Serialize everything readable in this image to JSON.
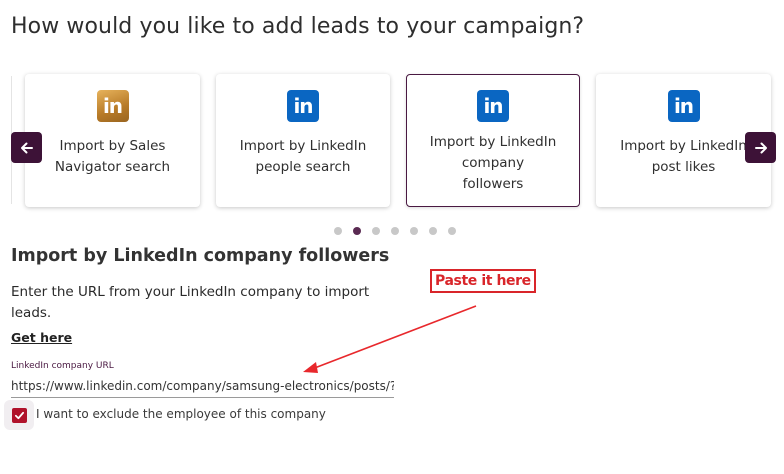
{
  "page": {
    "title": "How would you like to add leads to your campaign?"
  },
  "carousel": {
    "cards": [
      {
        "label_line1": "Import by Sales",
        "label_line2": "Navigator search",
        "label_line3": "",
        "icon": "linkedin-sales-navigator-icon",
        "selected": false
      },
      {
        "label_line1": "Import by LinkedIn",
        "label_line2": "people search",
        "label_line3": "",
        "icon": "linkedin-icon",
        "selected": false
      },
      {
        "label_line1": "Import by LinkedIn",
        "label_line2": "company",
        "label_line3": "followers",
        "icon": "linkedin-icon",
        "selected": true
      },
      {
        "label_line1": "Import by LinkedIn",
        "label_line2": "post likes",
        "label_line3": "",
        "icon": "linkedin-icon",
        "selected": false
      }
    ],
    "icon_text": "in",
    "prev_icon": "arrow-left-icon",
    "next_icon": "arrow-right-icon",
    "dots_count": 7,
    "active_dot": 2
  },
  "section": {
    "title": "Import by LinkedIn company followers",
    "description": "Enter the URL from your LinkedIn company to import leads.",
    "get_here_link": "Get here",
    "field_label": "LinkedIn company URL",
    "url_value": "https://www.linkedin.com/company/samsung-electronics/posts/?feedView=all",
    "url_placeholder": "",
    "exclude_checkbox": {
      "checked": true,
      "label": "I want to exclude the employee of this company"
    }
  },
  "annotation": {
    "callout_text": "Paste it here"
  },
  "colors": {
    "accent": "#4a1942",
    "nav_button": "#3d1237",
    "linkedin_blue": "#0a66c2",
    "checkbox": "#b0122b",
    "annotation_red": "#d9252a"
  }
}
